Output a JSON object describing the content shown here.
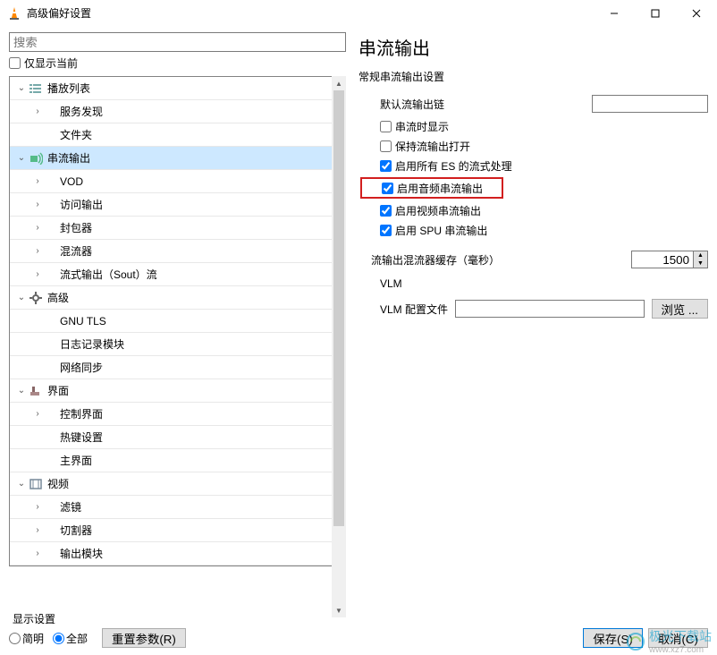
{
  "window": {
    "title": "高级偏好设置"
  },
  "left": {
    "search_placeholder": "搜索",
    "show_current": "仅显示当前",
    "tree": [
      {
        "lvl": 0,
        "caret": "down",
        "icon": "list",
        "label": "播放列表"
      },
      {
        "lvl": 1,
        "caret": "right",
        "icon": "",
        "label": "服务发现"
      },
      {
        "lvl": 1,
        "caret": "",
        "icon": "",
        "label": "文件夹"
      },
      {
        "lvl": 0,
        "caret": "down",
        "icon": "stream",
        "label": "串流输出",
        "selected": true
      },
      {
        "lvl": 1,
        "caret": "right",
        "icon": "",
        "label": "VOD"
      },
      {
        "lvl": 1,
        "caret": "right",
        "icon": "",
        "label": "访问输出"
      },
      {
        "lvl": 1,
        "caret": "right",
        "icon": "",
        "label": "封包器"
      },
      {
        "lvl": 1,
        "caret": "right",
        "icon": "",
        "label": "混流器"
      },
      {
        "lvl": 1,
        "caret": "right",
        "icon": "",
        "label": "流式输出（Sout）流"
      },
      {
        "lvl": 0,
        "caret": "down",
        "icon": "gear",
        "label": "高级"
      },
      {
        "lvl": 1,
        "caret": "",
        "icon": "",
        "label": "GNU TLS"
      },
      {
        "lvl": 1,
        "caret": "",
        "icon": "",
        "label": "日志记录模块"
      },
      {
        "lvl": 1,
        "caret": "",
        "icon": "",
        "label": "网络同步"
      },
      {
        "lvl": 0,
        "caret": "down",
        "icon": "brush",
        "label": "界面"
      },
      {
        "lvl": 1,
        "caret": "right",
        "icon": "",
        "label": "控制界面"
      },
      {
        "lvl": 1,
        "caret": "",
        "icon": "",
        "label": "热键设置"
      },
      {
        "lvl": 1,
        "caret": "",
        "icon": "",
        "label": "主界面"
      },
      {
        "lvl": 0,
        "caret": "down",
        "icon": "film",
        "label": "视频"
      },
      {
        "lvl": 1,
        "caret": "right",
        "icon": "",
        "label": "滤镜"
      },
      {
        "lvl": 1,
        "caret": "right",
        "icon": "",
        "label": "切割器"
      },
      {
        "lvl": 1,
        "caret": "right",
        "icon": "",
        "label": "输出模块"
      }
    ]
  },
  "right": {
    "title": "串流输出",
    "subhead": "常规串流输出设置",
    "chain_label": "默认流输出链",
    "checks": {
      "c1": {
        "label": "串流时显示",
        "checked": false
      },
      "c2": {
        "label": "保持流输出打开",
        "checked": false
      },
      "c3": {
        "label": "启用所有 ES 的流式处理",
        "checked": true
      },
      "c4": {
        "label": "启用音频串流输出",
        "checked": true
      },
      "c5": {
        "label": "启用视频串流输出",
        "checked": true
      },
      "c6": {
        "label": "启用 SPU 串流输出",
        "checked": true
      }
    },
    "mux_label": "流输出混流器缓存（毫秒）",
    "mux_value": "1500",
    "vlm_title": "VLM",
    "vlm_label": "VLM 配置文件",
    "browse": "浏览 ..."
  },
  "bottom": {
    "display_label": "显示设置",
    "simple": "简明",
    "all": "全部",
    "reset": "重置参数(R)",
    "save": "保存(S)",
    "cancel": "取消(C)"
  },
  "watermark": {
    "name": "极光下载站",
    "url": "www.xz7.com"
  }
}
